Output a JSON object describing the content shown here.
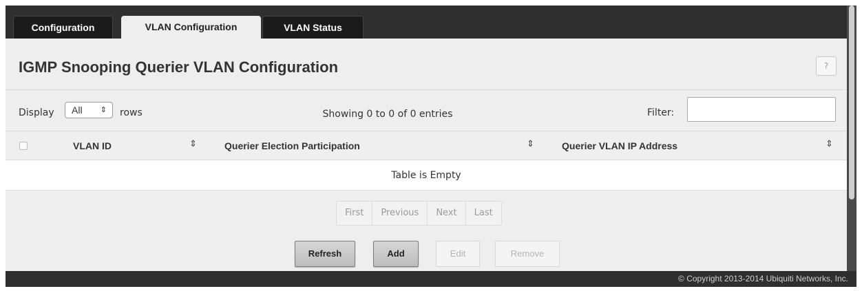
{
  "tabs": [
    {
      "label": "Configuration",
      "active": false
    },
    {
      "label": "VLAN Configuration",
      "active": true
    },
    {
      "label": "VLAN Status",
      "active": false
    }
  ],
  "page": {
    "title": "IGMP Snooping Querier VLAN Configuration",
    "help_label": "?"
  },
  "controls": {
    "display_label": "Display",
    "rows_value": "All",
    "rows_label": "rows",
    "showing_text": "Showing 0 to 0 of 0 entries",
    "filter_label": "Filter:",
    "filter_value": ""
  },
  "table": {
    "columns": [
      "VLAN ID",
      "Querier Election Participation",
      "Querier VLAN IP Address"
    ],
    "empty_text": "Table is Empty",
    "rows": []
  },
  "pagination": [
    "First",
    "Previous",
    "Next",
    "Last"
  ],
  "buttons": {
    "refresh": "Refresh",
    "add": "Add",
    "edit": "Edit",
    "remove": "Remove"
  },
  "footer": {
    "copyright": "© Copyright 2013-2014 Ubiquiti Networks, Inc."
  },
  "icons": {
    "sort": "sort-icon",
    "select_arrow": "chevron-updown-icon",
    "help": "help-icon"
  },
  "colors": {
    "chrome": "#2f2f2f",
    "panel": "#eeeeee",
    "tab_dark": "#1b1b1b"
  }
}
